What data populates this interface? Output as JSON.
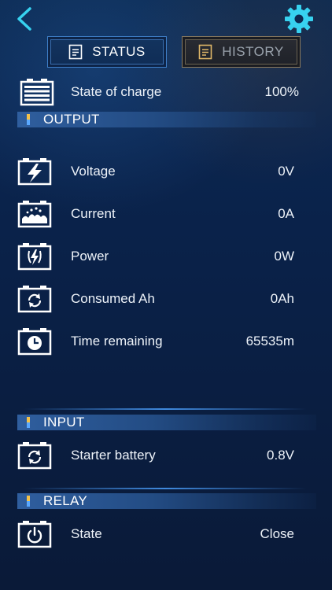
{
  "header": {
    "back_icon": "chevron-left-icon",
    "settings_icon": "gear-icon",
    "accent": "#37d2f0"
  },
  "tabs": [
    {
      "label": "STATUS",
      "active": true,
      "icon": "document-icon"
    },
    {
      "label": "HISTORY",
      "active": false,
      "icon": "document-icon"
    }
  ],
  "state_of_charge": {
    "label": "State of charge",
    "value": "100%",
    "icon": "battery-full-icon"
  },
  "output": {
    "title": "OUTPUT",
    "rows": [
      {
        "label": "Voltage",
        "value": "0V",
        "icon": "battery-bolt-icon"
      },
      {
        "label": "Current",
        "value": "0A",
        "icon": "battery-current-icon"
      },
      {
        "label": "Power",
        "value": "0W",
        "icon": "battery-power-icon"
      },
      {
        "label": "Consumed Ah",
        "value": "0Ah",
        "icon": "battery-cycle-icon"
      },
      {
        "label": "Time remaining",
        "value": "65535m",
        "icon": "battery-clock-icon"
      }
    ]
  },
  "input": {
    "title": "INPUT",
    "rows": [
      {
        "label": "Starter battery",
        "value": "0.8V",
        "icon": "battery-cycle-icon"
      }
    ]
  },
  "relay": {
    "title": "RELAY",
    "rows": [
      {
        "label": "State",
        "value": "Close",
        "icon": "battery-power-button-icon"
      }
    ]
  }
}
